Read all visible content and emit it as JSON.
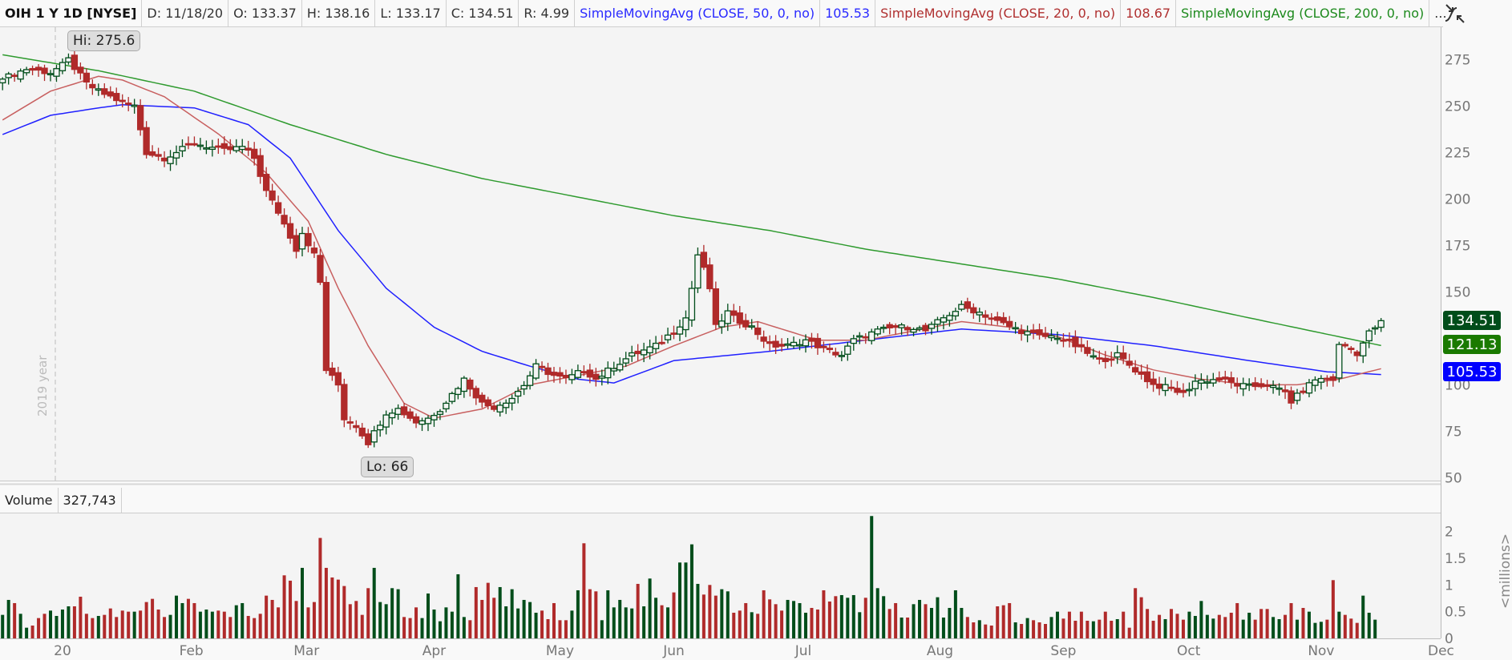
{
  "header": {
    "symbol": "OIH 1 Y 1D [NYSE]",
    "date": "D: 11/18/20",
    "open": "O: 133.37",
    "high": "H: 138.16",
    "low": "L: 133.17",
    "close": "C: 134.51",
    "range": "R: 4.99",
    "sma50_label": "SimpleMovingAvg (CLOSE, 50, 0, no)",
    "sma50_value": "105.53",
    "sma20_label": "SimpleMovingAvg (CLOSE, 20, 0, no)",
    "sma20_value": "108.67",
    "sma200_label": "SimpleMovingAvg (CLOSE, 200, 0, no)",
    "more": "...",
    "icon": "style-toggle-icon"
  },
  "annotations": {
    "hi": "Hi: 275.6",
    "lo": "Lo: 66",
    "year_marker": "2019 year"
  },
  "badges": {
    "last": "134.51",
    "sma200": "121.13",
    "sma50": "105.53"
  },
  "volume_panel": {
    "label": "Volume",
    "value": "327,743",
    "unit": "<millions>"
  },
  "colors": {
    "up": "#004d1a",
    "down": "#b02a2a",
    "sma50": "#2020ff",
    "sma20": "#c86060",
    "sma200": "#2e9a2e",
    "badge_last": "#004d1a",
    "badge_sma200": "#1a7a00",
    "badge_sma50": "#0000ff"
  },
  "chart_data": {
    "type": "candlestick",
    "title": "OIH 1 Y 1D [NYSE]",
    "ylim": [
      50,
      290
    ],
    "yticks": [
      275,
      250,
      225,
      200,
      175,
      150,
      100,
      75,
      50
    ],
    "xticks": [
      {
        "label": "20",
        "index": 10
      },
      {
        "label": "Feb",
        "index": 31.5
      },
      {
        "label": "Mar",
        "index": 50.7
      },
      {
        "label": "Apr",
        "index": 72
      },
      {
        "label": "May",
        "index": 93
      },
      {
        "label": "Jun",
        "index": 112
      },
      {
        "label": "Jul",
        "index": 133.6
      },
      {
        "label": "Aug",
        "index": 156.4
      },
      {
        "label": "Sep",
        "index": 177
      },
      {
        "label": "Oct",
        "index": 197.9
      },
      {
        "label": "Nov",
        "index": 220
      },
      {
        "label": "Dec",
        "index": 240
      }
    ],
    "n_bars": 231,
    "close_keypoints": [
      [
        0,
        266
      ],
      [
        1,
        266
      ],
      [
        4,
        270
      ],
      [
        8,
        268
      ],
      [
        10,
        272
      ],
      [
        11,
        275
      ],
      [
        14,
        262
      ],
      [
        16,
        258
      ],
      [
        18,
        255
      ],
      [
        20,
        252
      ],
      [
        22,
        250
      ],
      [
        24,
        225
      ],
      [
        27,
        222
      ],
      [
        32,
        230
      ],
      [
        37,
        226
      ],
      [
        40,
        228
      ],
      [
        42,
        222
      ],
      [
        44,
        204
      ],
      [
        46,
        193
      ],
      [
        48,
        180
      ],
      [
        49,
        173
      ],
      [
        50,
        182
      ],
      [
        52,
        170
      ],
      [
        53,
        155
      ],
      [
        54,
        108
      ],
      [
        56,
        100
      ],
      [
        57,
        82
      ],
      [
        59,
        78
      ],
      [
        61,
        69
      ],
      [
        64,
        85
      ],
      [
        66,
        87
      ],
      [
        69,
        80
      ],
      [
        71,
        82
      ],
      [
        73,
        87
      ],
      [
        75,
        95
      ],
      [
        77,
        103
      ],
      [
        80,
        90
      ],
      [
        82,
        88
      ],
      [
        85,
        93
      ],
      [
        87,
        100
      ],
      [
        89,
        110
      ],
      [
        92,
        105
      ],
      [
        94,
        103
      ],
      [
        97,
        108
      ],
      [
        99,
        103
      ],
      [
        102,
        110
      ],
      [
        105,
        116
      ],
      [
        109,
        121
      ],
      [
        112,
        129
      ],
      [
        114,
        136
      ],
      [
        115,
        152
      ],
      [
        116,
        170
      ],
      [
        117,
        162
      ],
      [
        118,
        152
      ],
      [
        119,
        131
      ],
      [
        121,
        139
      ],
      [
        122,
        136
      ],
      [
        125,
        131
      ],
      [
        128,
        121
      ],
      [
        131,
        121
      ],
      [
        134,
        124
      ],
      [
        138,
        118
      ],
      [
        140,
        116
      ],
      [
        142,
        124
      ],
      [
        146,
        129
      ],
      [
        149,
        131
      ],
      [
        152,
        131
      ],
      [
        154,
        129
      ],
      [
        157,
        136
      ],
      [
        160,
        142
      ],
      [
        163,
        139
      ],
      [
        166,
        134
      ],
      [
        170,
        129
      ],
      [
        173,
        126
      ],
      [
        176,
        126
      ],
      [
        179,
        121
      ],
      [
        183,
        113
      ],
      [
        186,
        116
      ],
      [
        189,
        108
      ],
      [
        192,
        100
      ],
      [
        195,
        98
      ],
      [
        197,
        95
      ],
      [
        199,
        102
      ],
      [
        203,
        103
      ],
      [
        206,
        100
      ],
      [
        208,
        99
      ],
      [
        211,
        100
      ],
      [
        214,
        96
      ],
      [
        215,
        91
      ],
      [
        218,
        100
      ],
      [
        219,
        103
      ],
      [
        222,
        103
      ],
      [
        223,
        121
      ],
      [
        224,
        121
      ],
      [
        226,
        117
      ],
      [
        228,
        128
      ],
      [
        229,
        131
      ],
      [
        230,
        134.51
      ]
    ],
    "series": [
      {
        "name": "SimpleMovingAvg (CLOSE, 200, 0, no)",
        "color": "#2e9a2e",
        "points": [
          [
            0,
            277.6
          ],
          [
            16,
            269
          ],
          [
            32,
            258
          ],
          [
            48,
            240
          ],
          [
            64,
            224
          ],
          [
            80,
            211
          ],
          [
            96,
            201
          ],
          [
            112,
            191
          ],
          [
            128,
            183
          ],
          [
            144,
            173
          ],
          [
            160,
            165
          ],
          [
            176,
            157
          ],
          [
            192,
            147
          ],
          [
            208,
            136
          ],
          [
            230,
            121.13
          ]
        ]
      },
      {
        "name": "SimpleMovingAvg (CLOSE, 50, 0, no)",
        "color": "#2020ff",
        "points": [
          [
            0,
            234.7
          ],
          [
            8,
            245
          ],
          [
            16,
            249
          ],
          [
            20,
            250.7
          ],
          [
            32,
            249
          ],
          [
            41,
            240
          ],
          [
            48,
            222
          ],
          [
            56,
            183
          ],
          [
            64,
            152
          ],
          [
            72,
            131
          ],
          [
            80,
            118
          ],
          [
            88,
            110
          ],
          [
            96,
            103
          ],
          [
            102,
            101
          ],
          [
            112,
            113
          ],
          [
            128,
            118
          ],
          [
            144,
            124
          ],
          [
            160,
            130
          ],
          [
            176,
            127
          ],
          [
            192,
            121
          ],
          [
            208,
            113
          ],
          [
            221,
            107
          ],
          [
            230,
            105.53
          ]
        ]
      },
      {
        "name": "SimpleMovingAvg (CLOSE, 20, 0, no)",
        "color": "#c86060",
        "points": [
          [
            0,
            242.5
          ],
          [
            8,
            258
          ],
          [
            16,
            266
          ],
          [
            20,
            264
          ],
          [
            27,
            255
          ],
          [
            36,
            235
          ],
          [
            44,
            214
          ],
          [
            51,
            188
          ],
          [
            56,
            152
          ],
          [
            61,
            121
          ],
          [
            67,
            90
          ],
          [
            72,
            82
          ],
          [
            80,
            87
          ],
          [
            88,
            100
          ],
          [
            96,
            105
          ],
          [
            104,
            110
          ],
          [
            112,
            121
          ],
          [
            120,
            131
          ],
          [
            126,
            134
          ],
          [
            136,
            124
          ],
          [
            144,
            124
          ],
          [
            152,
            129
          ],
          [
            160,
            134
          ],
          [
            168,
            131
          ],
          [
            176,
            126
          ],
          [
            184,
            116
          ],
          [
            192,
            108
          ],
          [
            200,
            103
          ],
          [
            208,
            100
          ],
          [
            216,
            100
          ],
          [
            223,
            103
          ],
          [
            230,
            108.67
          ]
        ]
      }
    ],
    "volume": {
      "unit": "millions",
      "ylim": [
        0,
        2.3
      ],
      "yticks": [
        0,
        0.5,
        1,
        1.5,
        2
      ],
      "values": [
        0.44,
        0.72,
        0.66,
        0.46,
        0.2,
        0.24,
        0.38,
        0.46,
        0.52,
        0.42,
        0.54,
        0.6,
        0.6,
        0.78,
        0.46,
        0.38,
        0.42,
        0.44,
        0.56,
        0.4,
        0.52,
        0.5,
        0.5,
        0.52,
        0.68,
        0.74,
        0.54,
        0.4,
        0.44,
        0.8,
        0.66,
        0.74,
        0.66,
        0.5,
        0.54,
        0.5,
        0.52,
        0.5,
        0.4,
        0.62,
        0.66,
        0.42,
        0.38,
        0.46,
        0.8,
        0.72,
        0.58,
        1.18,
        1.08,
        0.7,
        1.32,
        0.58,
        0.68,
        1.88,
        1.32,
        1.14,
        1.1,
        0.98,
        0.64,
        0.7,
        0.44,
        0.94,
        1.32,
        0.68,
        0.64,
        0.94,
        0.92,
        0.4,
        0.38,
        0.58,
        0.38,
        0.84,
        0.54,
        0.32,
        0.58,
        0.5,
        1.2,
        0.4,
        0.34,
        0.96,
        0.72,
        1.04,
        0.76,
        0.96,
        0.6,
        0.92,
        0.56,
        0.72,
        0.68,
        0.48,
        0.52,
        0.36,
        0.66,
        0.34,
        0.34,
        0.52,
        0.9,
        1.78,
        0.92,
        0.88,
        0.34,
        0.9,
        0.58,
        0.72,
        0.58,
        0.56,
        1.02,
        0.6,
        1.12,
        0.76,
        0.62,
        0.58,
        0.86,
        1.42,
        1.42,
        1.76,
        1.02,
        0.82,
        1.0,
        0.8,
        0.92,
        0.88,
        0.48,
        0.52,
        0.66,
        0.49,
        0.46,
        0.9,
        0.73,
        0.64,
        0.52,
        0.72,
        0.7,
        0.66,
        0.48,
        0.57,
        0.54,
        0.9,
        0.69,
        0.79,
        0.81,
        0.76,
        0.81,
        0.49,
        0.76,
        2.29,
        0.94,
        0.79,
        0.55,
        0.66,
        0.39,
        0.39,
        0.64,
        0.72,
        0.64,
        0.57,
        0.77,
        0.39,
        0.57,
        0.9,
        0.57,
        0.4,
        0.3,
        0.34,
        0.26,
        0.24,
        0.6,
        0.62,
        0.66,
        0.3,
        0.27,
        0.38,
        0.34,
        0.3,
        0.27,
        0.4,
        0.5,
        0.37,
        0.5,
        0.33,
        0.5,
        0.33,
        0.32,
        0.35,
        0.5,
        0.33,
        0.36,
        0.5,
        0.2,
        0.94,
        0.77,
        0.55,
        0.33,
        0.44,
        0.36,
        0.55,
        0.46,
        0.35,
        0.5,
        0.42,
        0.7,
        0.44,
        0.37,
        0.44,
        0.4,
        0.48,
        0.66,
        0.35,
        0.48,
        0.35,
        0.55,
        0.55,
        0.4,
        0.36,
        0.44,
        0.66,
        0.35,
        0.57,
        0.5,
        0.29,
        0.31,
        0.35,
        1.09,
        0.5,
        0.44,
        0.37,
        0.29,
        0.8,
        0.48,
        0.35
      ]
    }
  }
}
